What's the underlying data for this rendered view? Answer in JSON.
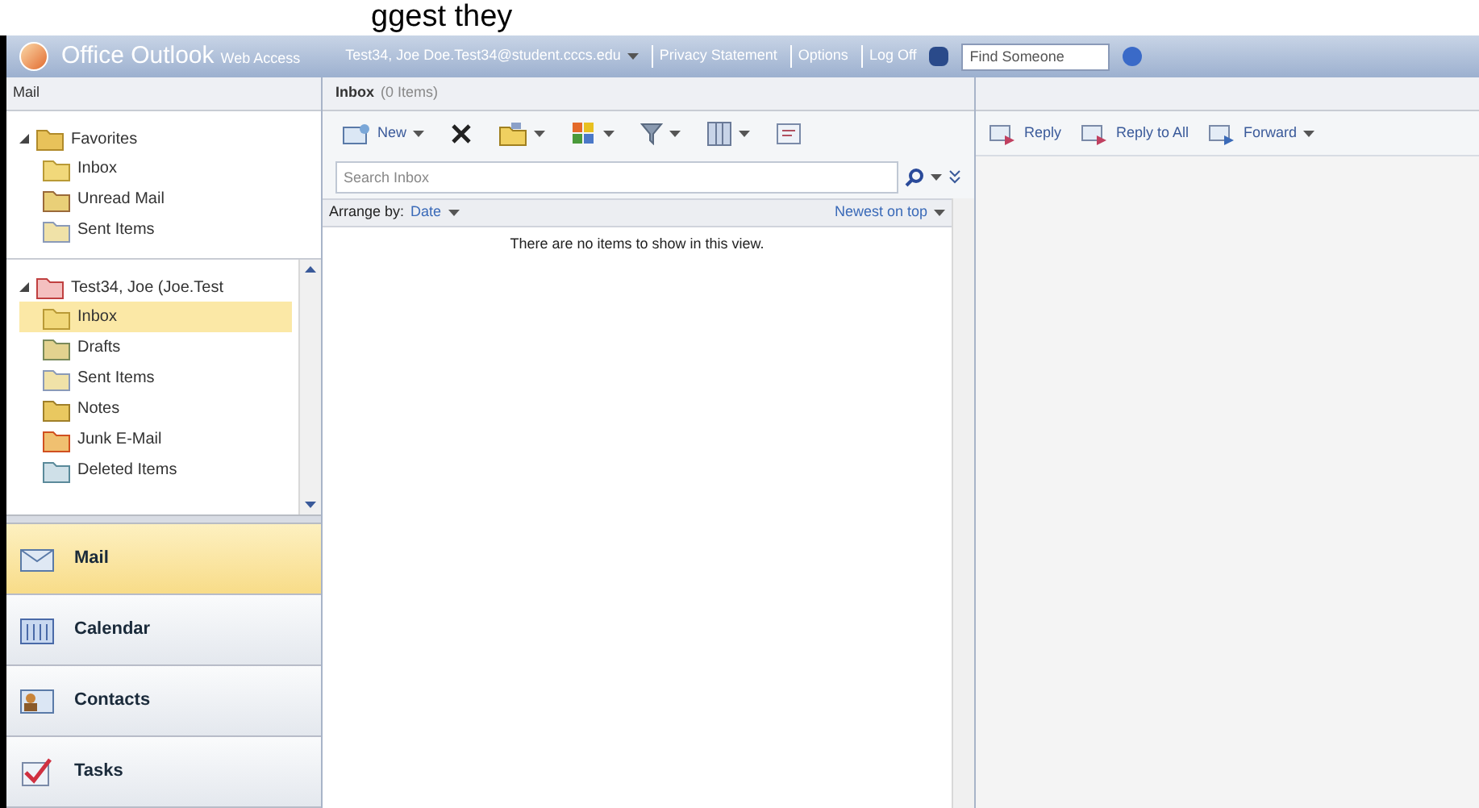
{
  "caption": "ggest they",
  "header": {
    "brand": "Office Outlook",
    "brand_sub": "Web Access",
    "user": "Test34, Joe Doe.Test34@student.cccs.edu",
    "links": [
      "Privacy Statement",
      "Options",
      "Log Off"
    ],
    "find_placeholder": "Find Someone"
  },
  "left": {
    "title": "Mail",
    "trees": [
      {
        "label": "Favorites",
        "kind": "favorites",
        "expanded": true,
        "children": [
          {
            "label": "Inbox",
            "kind": "inbox",
            "selected": false
          },
          {
            "label": "Unread Mail",
            "kind": "unread",
            "selected": false
          },
          {
            "label": "Sent Items",
            "kind": "sent",
            "selected": false
          }
        ]
      },
      {
        "label": "Test34, Joe (Joe.Test",
        "kind": "mailbox",
        "expanded": true,
        "children": [
          {
            "label": "Inbox",
            "kind": "inbox",
            "selected": true
          },
          {
            "label": "Drafts",
            "kind": "drafts",
            "selected": false
          },
          {
            "label": "Sent Items",
            "kind": "sent",
            "selected": false
          },
          {
            "label": "Notes",
            "kind": "notes",
            "selected": false
          },
          {
            "label": "Junk E-Mail",
            "kind": "junk",
            "selected": false
          },
          {
            "label": "Deleted Items",
            "kind": "deleted",
            "selected": false
          }
        ]
      }
    ]
  },
  "nav": [
    {
      "label": "Mail",
      "kind": "mail",
      "selected": true
    },
    {
      "label": "Calendar",
      "kind": "calendar",
      "selected": false
    },
    {
      "label": "Contacts",
      "kind": "contacts",
      "selected": false
    },
    {
      "label": "Tasks",
      "kind": "tasks",
      "selected": false
    }
  ],
  "middle": {
    "title": "Inbox",
    "count": "(0 Items)",
    "toolbar": [
      {
        "kind": "new",
        "label": "New",
        "dropdown": true
      },
      {
        "kind": "delete",
        "dropdown": false
      },
      {
        "kind": "move",
        "dropdown": true
      },
      {
        "kind": "categories",
        "dropdown": true
      },
      {
        "kind": "filter",
        "dropdown": true
      },
      {
        "kind": "view",
        "dropdown": true
      },
      {
        "kind": "folder",
        "dropdown": false
      }
    ],
    "search_placeholder": "Search Inbox",
    "arrange_label": "Arrange by:",
    "arrange_value": "Date",
    "sort": "Newest on top",
    "empty": "There are no items to show in this view."
  },
  "reading": {
    "actions": [
      {
        "kind": "reply",
        "label": "Reply",
        "dropdown": false
      },
      {
        "kind": "reply-all",
        "label": "Reply to All",
        "dropdown": false
      },
      {
        "kind": "forward",
        "label": "Forward",
        "dropdown": true
      }
    ]
  }
}
